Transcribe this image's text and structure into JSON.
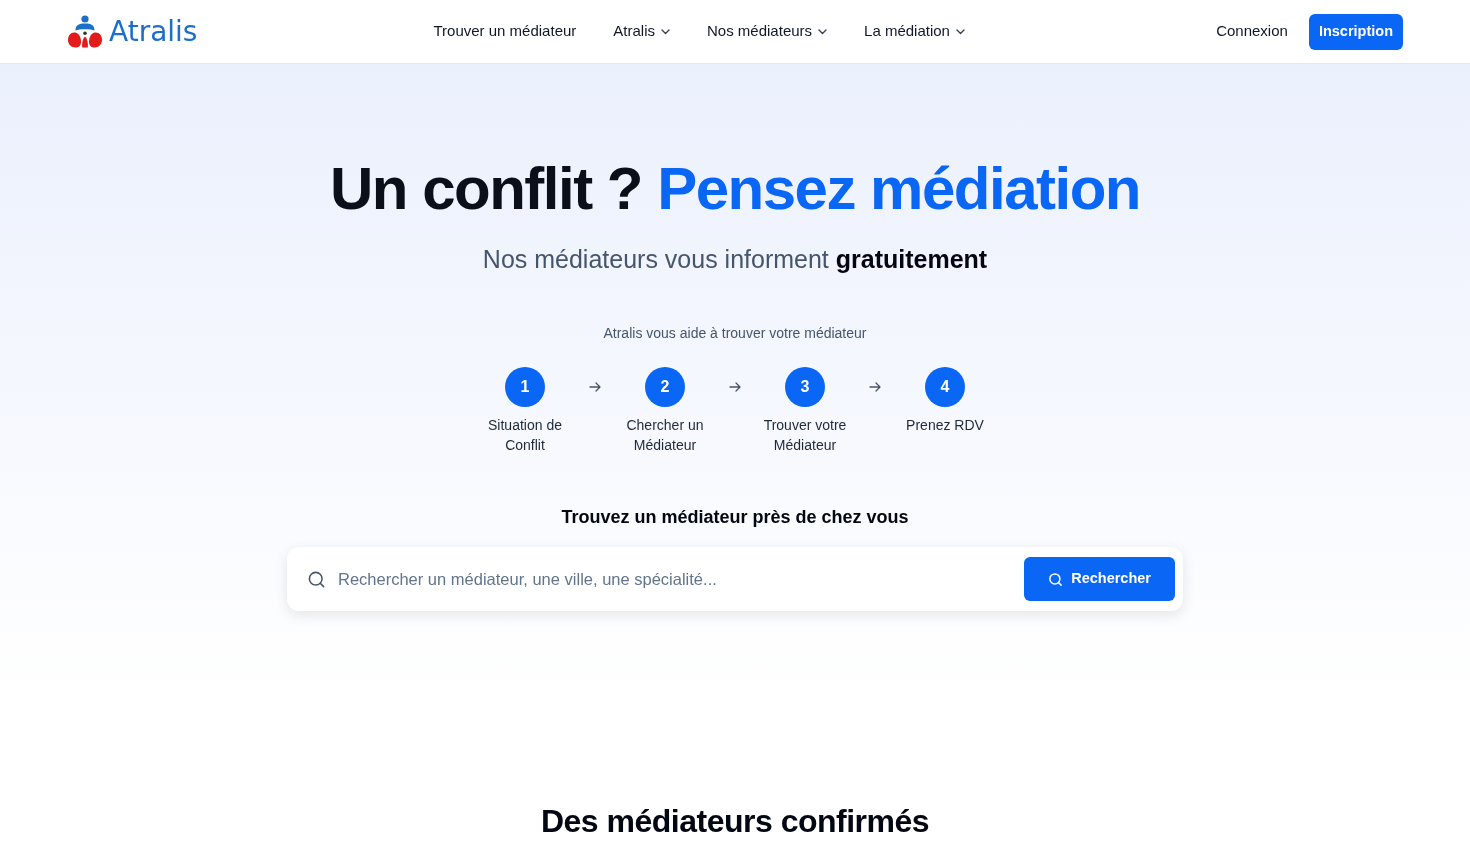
{
  "header": {
    "logo": {
      "text": "Atralis"
    },
    "nav": [
      {
        "label": "Trouver un médiateur",
        "dropdown": false
      },
      {
        "label": "Atralis",
        "dropdown": true
      },
      {
        "label": "Nos médiateurs",
        "dropdown": true
      },
      {
        "label": "La médiation",
        "dropdown": true
      }
    ],
    "login": "Connexion",
    "signup": "Inscription"
  },
  "hero": {
    "headline": "Un conflit ?",
    "headline_highlight": "Pensez médiation",
    "subtitle": "Nos médiateurs vous informent **gratuitement**",
    "steps_intro": "Atralis vous aide à trouver votre médiateur",
    "steps": [
      {
        "number": "1",
        "label": "Situation de Conflit"
      },
      {
        "number": "2",
        "label": "Chercher un Médiateur"
      },
      {
        "number": "3",
        "label": "Trouver votre Médiateur"
      },
      {
        "number": "4",
        "label": "Prenez RDV"
      }
    ],
    "search_title": "Trouvez un médiateur près de chez vous",
    "search": {
      "placeholder": "Rechercher un médiateur, une ville, une spécialité...",
      "button": "Rechercher"
    }
  },
  "section": {
    "title": "Des médiateurs confirmés"
  }
}
